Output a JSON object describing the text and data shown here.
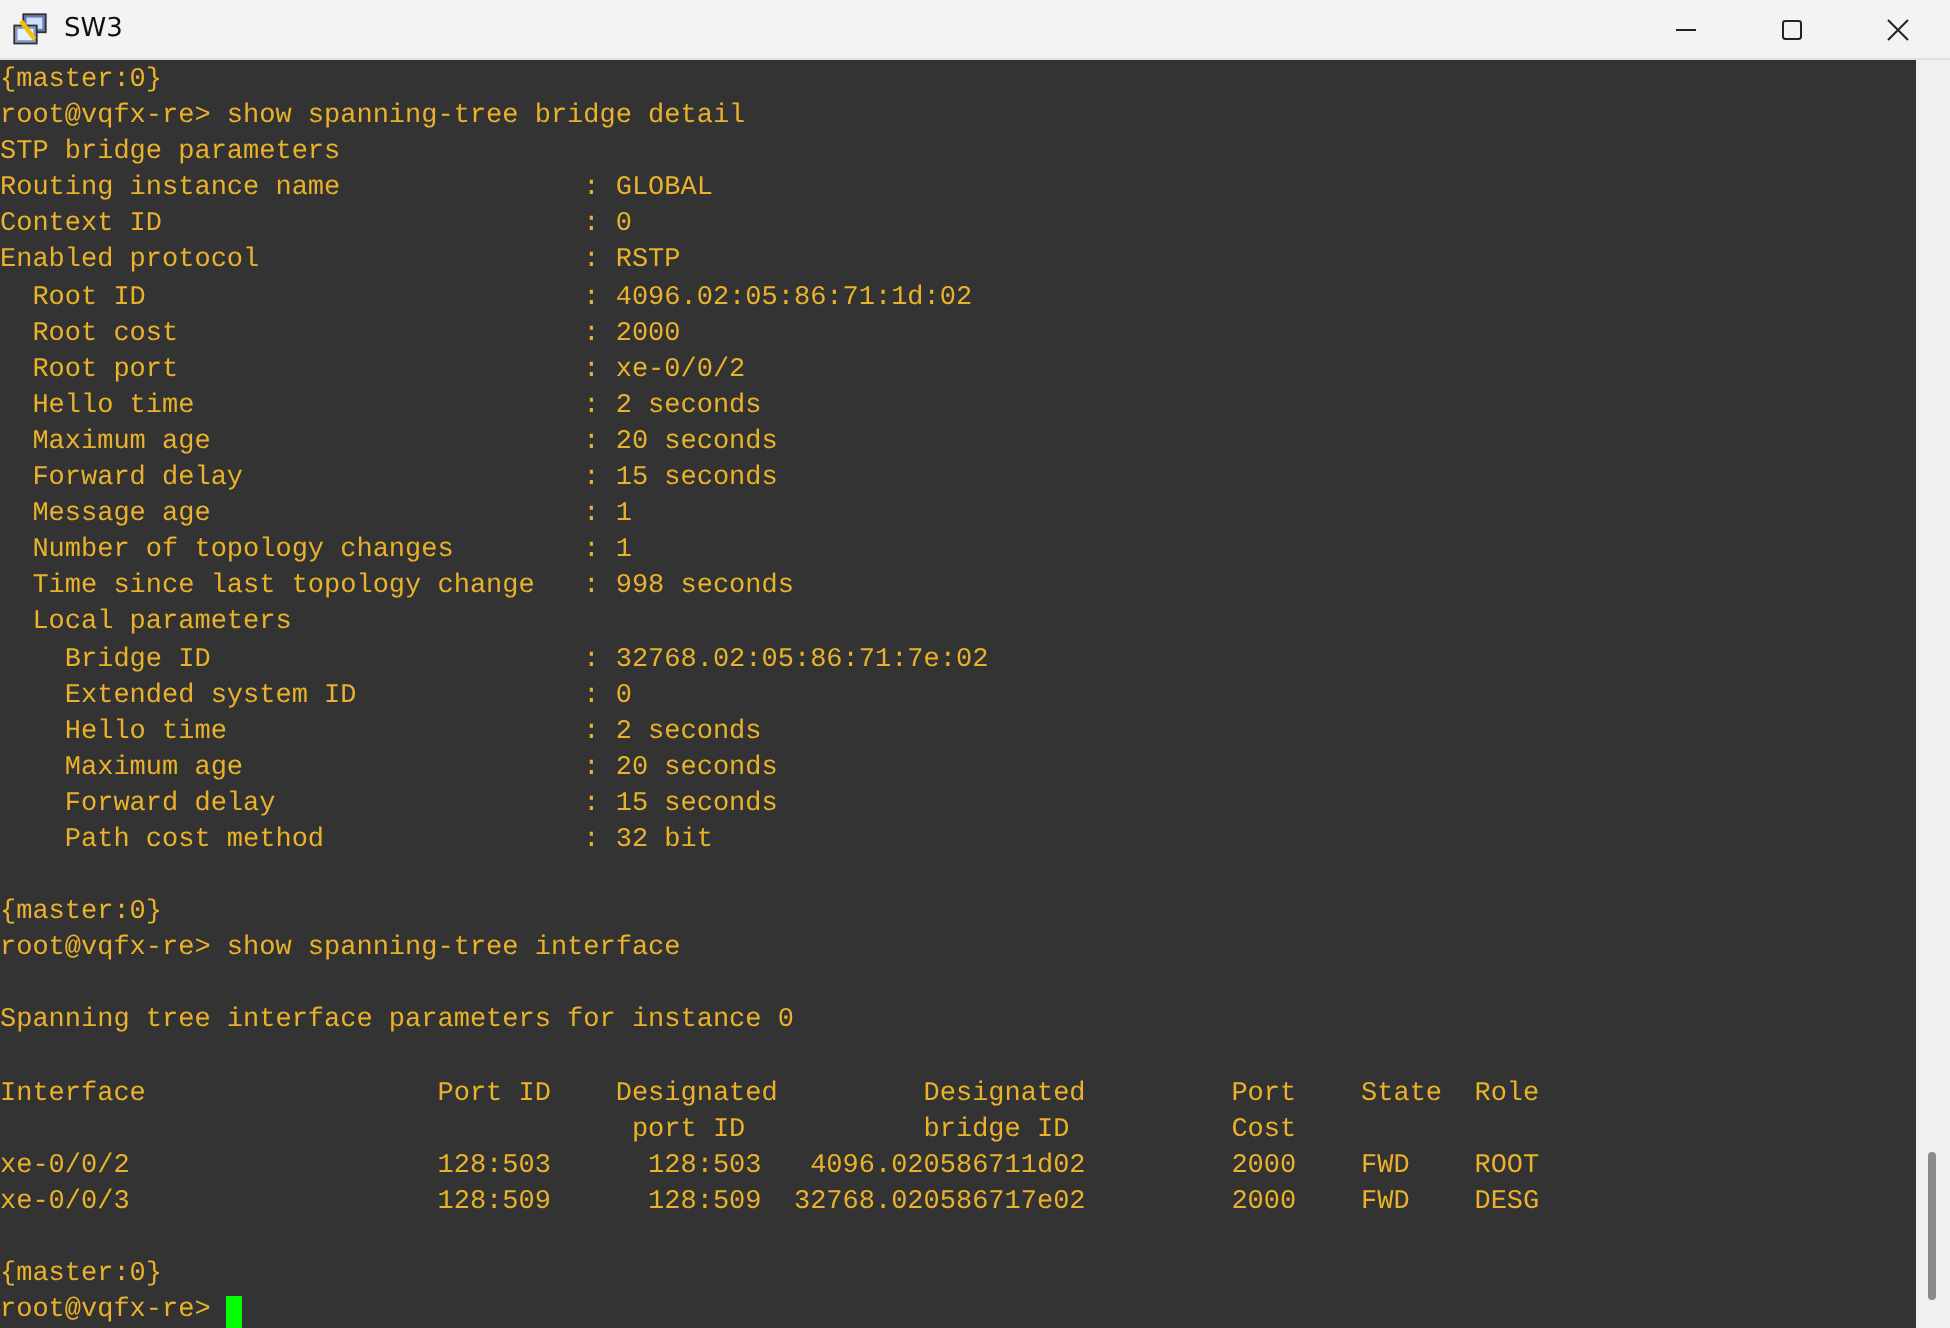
{
  "window": {
    "title": "SW3"
  },
  "terminal": {
    "lines": [
      {
        "kind": "text",
        "text": "{master:0}"
      },
      {
        "kind": "text",
        "text": "root@vqfx-re> show spanning-tree bridge detail"
      },
      {
        "kind": "text",
        "text": "STP bridge parameters"
      },
      {
        "kind": "text",
        "text": "Routing instance name               : GLOBAL"
      },
      {
        "kind": "text",
        "text": "Context ID                          : 0"
      },
      {
        "kind": "text",
        "text": "Enabled protocol                    : RSTP"
      },
      {
        "kind": "text",
        "text": "  Root ID                           : 4096.02:05:86:71:1d:02"
      },
      {
        "kind": "text",
        "text": "  Root cost                         : 2000"
      },
      {
        "kind": "text",
        "text": "  Root port                         : xe-0/0/2"
      },
      {
        "kind": "text",
        "text": "  Hello time                        : 2 seconds"
      },
      {
        "kind": "text",
        "text": "  Maximum age                       : 20 seconds"
      },
      {
        "kind": "text",
        "text": "  Forward delay                     : 15 seconds"
      },
      {
        "kind": "text",
        "text": "  Message age                       : 1"
      },
      {
        "kind": "text",
        "text": "  Number of topology changes        : 1"
      },
      {
        "kind": "text",
        "text": "  Time since last topology change   : 998 seconds"
      },
      {
        "kind": "text",
        "text": "  Local parameters"
      },
      {
        "kind": "text",
        "text": "    Bridge ID                       : 32768.02:05:86:71:7e:02"
      },
      {
        "kind": "text",
        "text": "    Extended system ID              : 0"
      },
      {
        "kind": "text",
        "text": "    Hello time                      : 2 seconds"
      },
      {
        "kind": "text",
        "text": "    Maximum age                     : 20 seconds"
      },
      {
        "kind": "text",
        "text": "    Forward delay                   : 15 seconds"
      },
      {
        "kind": "text",
        "text": "    Path cost method                : 32 bit"
      },
      {
        "kind": "blank"
      },
      {
        "kind": "text",
        "text": "{master:0}"
      },
      {
        "kind": "text",
        "text": "root@vqfx-re> show spanning-tree interface"
      },
      {
        "kind": "blank"
      },
      {
        "kind": "text",
        "text": "Spanning tree interface parameters for instance 0"
      },
      {
        "kind": "blank"
      },
      {
        "kind": "text",
        "text": "Interface                  Port ID    Designated         Designated         Port    State  Role"
      },
      {
        "kind": "text",
        "text": "                                       port ID           bridge ID          Cost"
      },
      {
        "kind": "text",
        "text": "xe-0/0/2                   128:503      128:503   4096.020586711d02         2000    FWD    ROOT"
      },
      {
        "kind": "text",
        "text": "xe-0/0/3                   128:509      128:509  32768.020586717e02         2000    FWD    DESG"
      },
      {
        "kind": "blank"
      },
      {
        "kind": "text",
        "text": "{master:0}"
      },
      {
        "kind": "prompt",
        "text": "root@vqfx-re> "
      }
    ]
  }
}
